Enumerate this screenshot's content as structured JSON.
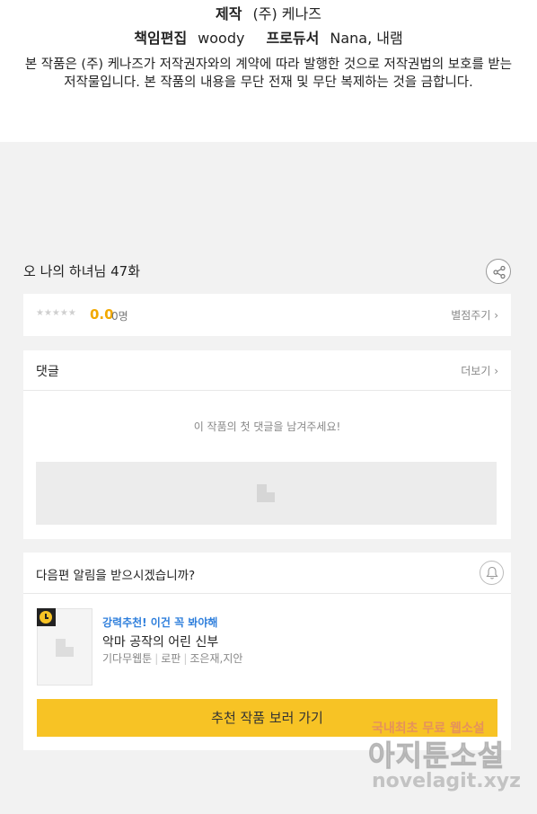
{
  "credits": {
    "production_label": "제작",
    "production_value": "(주) 케나즈",
    "editor_label": "책임편집",
    "editor_value": "woody",
    "producer_label": "프로듀서",
    "producer_value": "Nana, 내램",
    "notice": "본 작품은 (주) 케나즈가 저작권자와의 계약에 따라 발행한 것으로 저작권법의 보호를 받는 저작물입니다. 본 작품의 내용을 무단 전재 및 무단 복제하는 것을 금합니다."
  },
  "episode": {
    "title": "오 나의 하녀님 47화",
    "share_icon": "share-icon"
  },
  "rating": {
    "stars": "★★★★★",
    "score": "0.0",
    "count": "0명",
    "rate_link": "별점주기 ›"
  },
  "comments": {
    "title": "댓글",
    "more_link": "더보기 ›",
    "empty_message": "이 작품의 첫 댓글을 남겨주세요!"
  },
  "notify": {
    "question": "다음편 알림을 받으시겠습니까?",
    "bell_icon": "bell-icon"
  },
  "recommendation": {
    "tag": "강력추천! 이건 꼭 봐야해",
    "title": "악마 공작의 어린 신부",
    "meta": [
      "기다무웹툰",
      "로판",
      "조은재,지안"
    ],
    "button": "추천 작품 보러 가기"
  },
  "watermark": {
    "line1": "국내최초 무료 웹소설",
    "line2": "아지툰소설",
    "line3": "novelagit.xyz"
  },
  "colors": {
    "accent_yellow": "#f7c325",
    "score_orange": "#f2a900",
    "link_blue": "#2f7fdc",
    "background": "#f2f2f2"
  }
}
